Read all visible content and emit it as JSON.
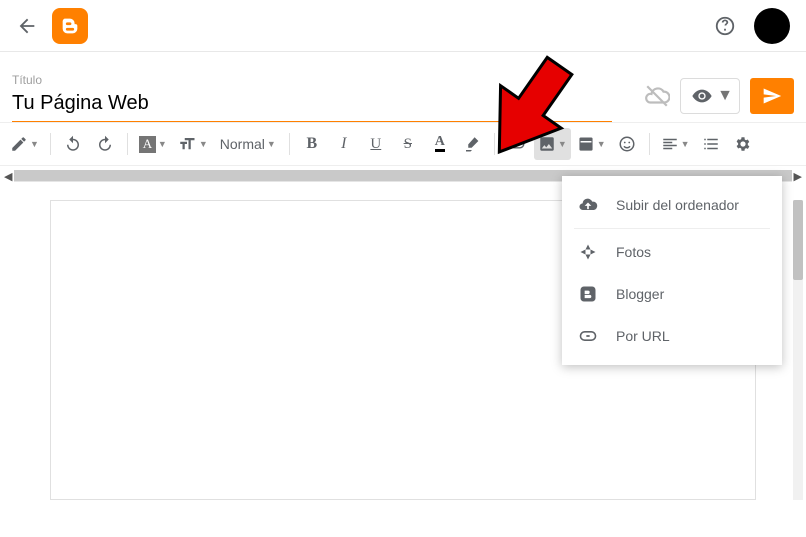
{
  "title_label": "Título",
  "title_value": "Tu Página Web",
  "toolbar": {
    "paragraph_style": "Normal"
  },
  "image_menu": {
    "upload": "Subir del ordenador",
    "photos": "Fotos",
    "blogger": "Blogger",
    "by_url": "Por URL"
  }
}
